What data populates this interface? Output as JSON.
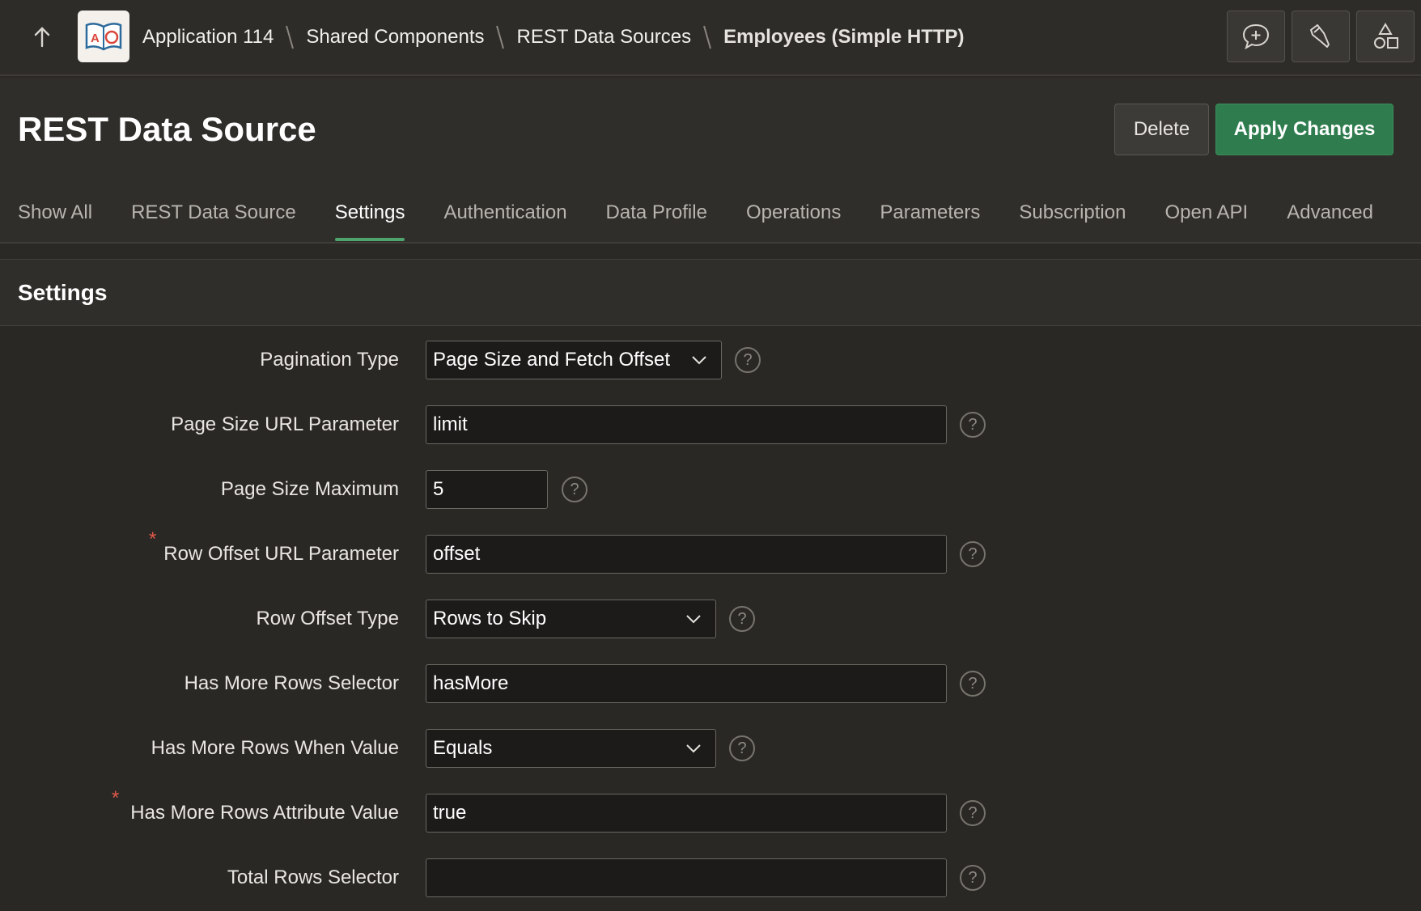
{
  "topbar": {
    "app_logo_text": "AO",
    "breadcrumb": [
      "Application 114",
      "Shared Components",
      "REST Data Sources"
    ],
    "current": "Employees (Simple HTTP)"
  },
  "header": {
    "title": "REST Data Source",
    "delete_label": "Delete",
    "apply_label": "Apply Changes"
  },
  "tabs": [
    "Show All",
    "REST Data Source",
    "Settings",
    "Authentication",
    "Data Profile",
    "Operations",
    "Parameters",
    "Subscription",
    "Open API",
    "Advanced"
  ],
  "active_tab": "Settings",
  "section": {
    "title": "Settings",
    "fields": {
      "pagination_type": {
        "label": "Pagination Type",
        "value": "Page Size and Fetch Offset"
      },
      "page_size_param": {
        "label": "Page Size URL Parameter",
        "value": "limit"
      },
      "page_size_max": {
        "label": "Page Size Maximum",
        "value": "5"
      },
      "row_offset_param": {
        "label": "Row Offset URL Parameter",
        "value": "offset",
        "required": true
      },
      "row_offset_type": {
        "label": "Row Offset Type",
        "value": "Rows to Skip"
      },
      "has_more_selector": {
        "label": "Has More Rows Selector",
        "value": "hasMore"
      },
      "has_more_when": {
        "label": "Has More Rows When Value",
        "value": "Equals"
      },
      "has_more_attr": {
        "label": "Has More Rows Attribute Value",
        "value": "true",
        "required": true
      },
      "total_rows_selector": {
        "label": "Total Rows Selector",
        "value": ""
      }
    },
    "required_mark": "*",
    "help_glyph": "?"
  },
  "colors": {
    "accent_green": "#2f7d4e",
    "tab_underline": "#4fa36c",
    "required": "#e0584a"
  }
}
